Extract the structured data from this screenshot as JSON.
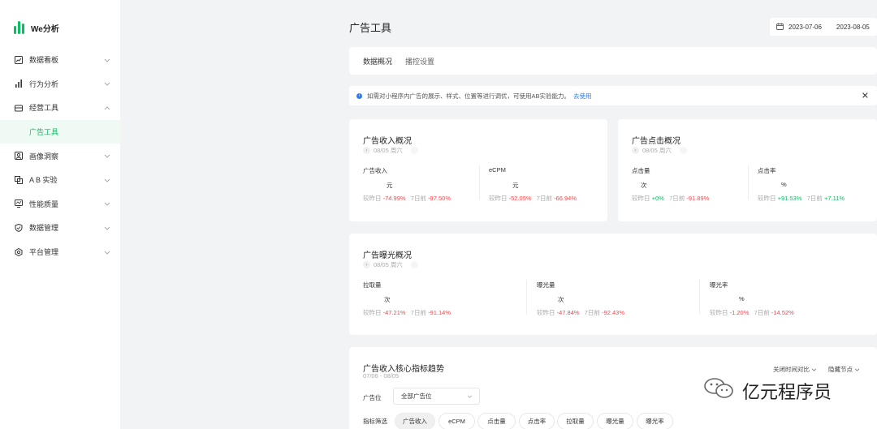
{
  "app": {
    "name": "We分析"
  },
  "sidebar": {
    "items": [
      {
        "label": "数据看板",
        "icon": "chart-board-icon"
      },
      {
        "label": "行为分析",
        "icon": "bar-chart-icon"
      },
      {
        "label": "经营工具",
        "icon": "toolbox-icon",
        "expanded": true
      },
      {
        "label": "画像洞察",
        "icon": "portrait-icon"
      },
      {
        "label": "A B 实验",
        "icon": "ab-test-icon"
      },
      {
        "label": "性能质量",
        "icon": "monitor-icon"
      },
      {
        "label": "数据管理",
        "icon": "shield-icon"
      },
      {
        "label": "平台管理",
        "icon": "gear-icon"
      }
    ],
    "sub_item": "广告工具"
  },
  "header": {
    "title": "广告工具",
    "date_start": "2023-07-06",
    "date_end": "2023-08-05"
  },
  "tabs": [
    "数据概况",
    "播控设置"
  ],
  "notice": {
    "text": "如需对小程序内广告的展示、样式、位置等进行调优，可使用AB实验能力。",
    "link": "去使用"
  },
  "revenue_card": {
    "title": "广告收入概况",
    "date": "08/05 周六",
    "metrics": [
      {
        "label": "广告收入",
        "unit": "元",
        "cmp1_label": "较昨日",
        "cmp1": "-74.99%",
        "cmp2_label": "7日前",
        "cmp2": "-97.50%"
      },
      {
        "label": "eCPM",
        "unit": "元",
        "cmp1_label": "较昨日",
        "cmp1": "-52.05%",
        "cmp2_label": "7日前",
        "cmp2": "-66.94%"
      }
    ]
  },
  "click_card": {
    "title": "广告点击概况",
    "date": "08/05 周六",
    "metrics": [
      {
        "label": "点击量",
        "unit": "次",
        "cmp1_label": "较昨日",
        "cmp1": "+0%",
        "cmp2_label": "7日前",
        "cmp2": "-91.89%"
      },
      {
        "label": "点击率",
        "unit": "%",
        "cmp1_label": "较昨日",
        "cmp1": "+91.53%",
        "cmp2_label": "7日前",
        "cmp2": "+7.11%"
      }
    ]
  },
  "exposure_card": {
    "title": "广告曝光概况",
    "date": "08/05 周六",
    "metrics": [
      {
        "label": "拉取量",
        "unit": "次",
        "cmp1_label": "较昨日",
        "cmp1": "-47.21%",
        "cmp2_label": "7日前",
        "cmp2": "-91.14%"
      },
      {
        "label": "曝光量",
        "unit": "次",
        "cmp1_label": "较昨日",
        "cmp1": "-47.84%",
        "cmp2_label": "7日前",
        "cmp2": "-92.43%"
      },
      {
        "label": "曝光率",
        "unit": "%",
        "cmp1_label": "较昨日",
        "cmp1": "-1.20%",
        "cmp2_label": "7日前",
        "cmp2": "-14.52%"
      }
    ]
  },
  "trend_card": {
    "title": "广告收入核心指标趋势",
    "range": "07/06 - 08/05",
    "toggle_compare": "关闭时间对比",
    "hide_nodes": "隐藏节点",
    "slot_label": "广告位",
    "slot_value": "全部广告位",
    "filter_label": "指标筛选",
    "chips": [
      "广告收入",
      "eCPM",
      "点击量",
      "点击率",
      "拉取量",
      "曝光量",
      "曝光率"
    ]
  },
  "watermark": {
    "text": "亿元程序员",
    "icon": "wechat-icon"
  },
  "colors": {
    "brand": "#07c160",
    "negative": "#f5474c",
    "positive": "#07c160",
    "link": "#2b7cf6"
  }
}
